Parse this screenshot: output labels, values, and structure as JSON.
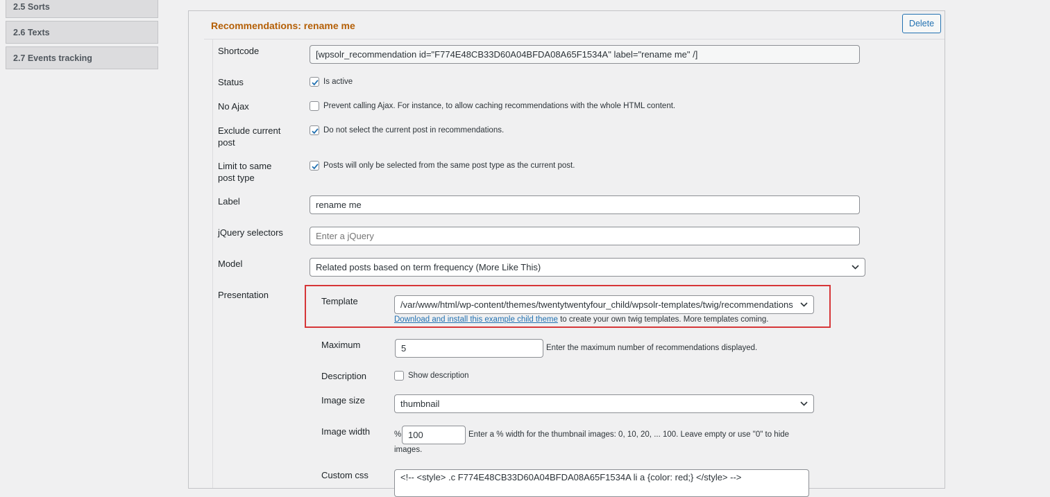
{
  "sidebar": {
    "items": [
      {
        "label": "2.5 Sorts"
      },
      {
        "label": "2.6 Texts"
      },
      {
        "label": "2.7 Events tracking"
      }
    ]
  },
  "panel": {
    "title": "Recommendations: rename me",
    "delete_label": "Delete"
  },
  "form": {
    "shortcode": {
      "label": "Shortcode",
      "value": "[wpsolr_recommendation id=\"F774E48CB33D60A04BFDA08A65F1534A\" label=\"rename me\" /]"
    },
    "status": {
      "label": "Status",
      "checkbox_text": "Is active",
      "checked": true
    },
    "no_ajax": {
      "label": "No Ajax",
      "checkbox_text": "Prevent calling Ajax. For instance, to allow caching recommendations with the whole HTML content.",
      "checked": false
    },
    "exclude_current": {
      "label_line1": "Exclude current",
      "label_line2": "post",
      "checkbox_text": "Do not select the current post in recommendations.",
      "checked": true
    },
    "limit_same": {
      "label_line1": "Limit to same",
      "label_line2": "post type",
      "checkbox_text": "Posts will only be selected from the same post type as the current post.",
      "checked": true
    },
    "label_field": {
      "label": "Label",
      "value": "rename me"
    },
    "jquery": {
      "label": "jQuery selectors",
      "placeholder": "Enter a jQuery"
    },
    "model": {
      "label": "Model",
      "selected": "Related posts based on term frequency (More Like This)"
    },
    "presentation": {
      "label": "Presentation",
      "template": {
        "label": "Template",
        "selected": "/var/www/html/wp-content/themes/twentytwentyfour_child/wpsolr-templates/twig/recommendations",
        "link_text": "Download and install this example child theme",
        "after_link": " to create your own twig templates. More templates coming."
      },
      "maximum": {
        "label": "Maximum",
        "value": "5",
        "help": "Enter the maximum number of recommendations displayed."
      },
      "description": {
        "label": "Description",
        "checkbox_text": "Show description",
        "checked": false
      },
      "image_size": {
        "label": "Image size",
        "selected": "thumbnail"
      },
      "image_width": {
        "label": "Image width",
        "prefix": "%",
        "value": "100",
        "help_line1": "Enter a % width for the thumbnail images: 0, 10, 20, ... 100. Leave empty or use \"0\" to hide",
        "help_line2": "images."
      },
      "custom_css": {
        "label": "Custom css",
        "value": "<!-- <style> .c F774E48CB33D60A04BFDA08A65F1534A li a {color: red;} </style> -->"
      }
    }
  },
  "colors": {
    "accent": "#2271b1",
    "title": "#b45f06",
    "highlight": "#d63638",
    "background": "#f0f0f1"
  }
}
